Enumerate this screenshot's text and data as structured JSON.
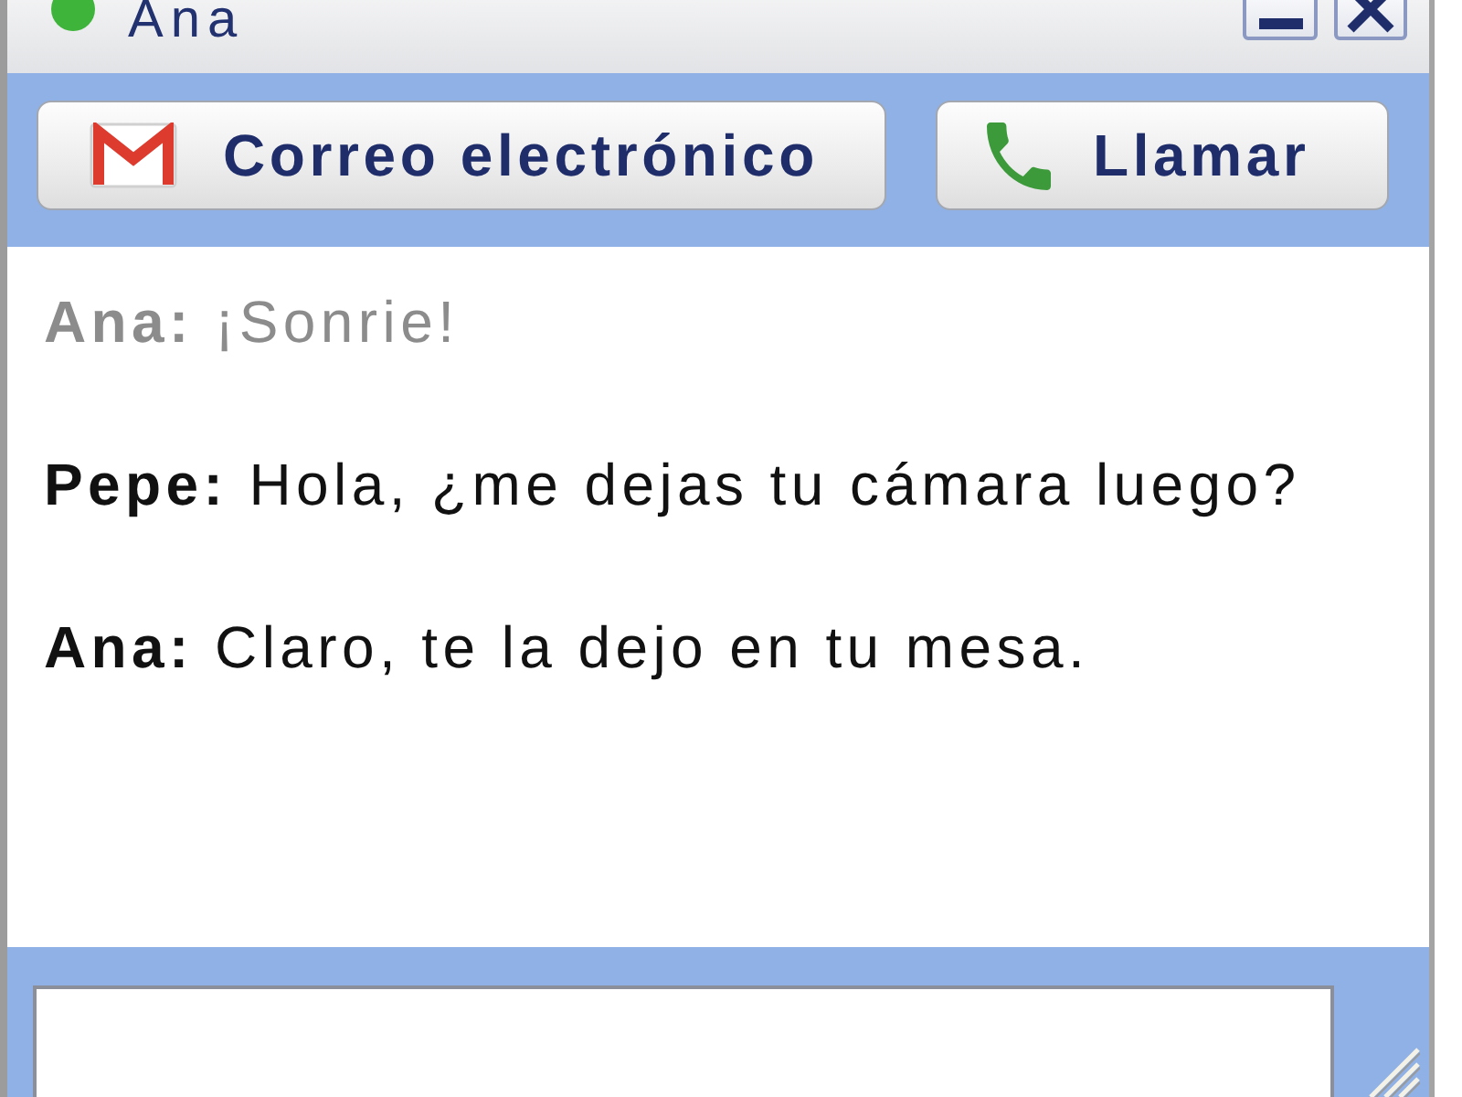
{
  "window": {
    "title": "Ana",
    "online": true
  },
  "toolbar": {
    "buttons": [
      {
        "kind": "email",
        "label": "Correo electrónico"
      },
      {
        "kind": "call",
        "label": "Llamar"
      }
    ]
  },
  "messages": [
    {
      "sender": "Ana:",
      "text": "¡Sonrie!",
      "faded": true
    },
    {
      "sender": "Pepe:",
      "text": "Hola, ¿me dejas tu cámara luego?",
      "faded": false
    },
    {
      "sender": "Ana:",
      "text": "Claro, te la dejo en tu mesa.",
      "faded": false
    }
  ]
}
